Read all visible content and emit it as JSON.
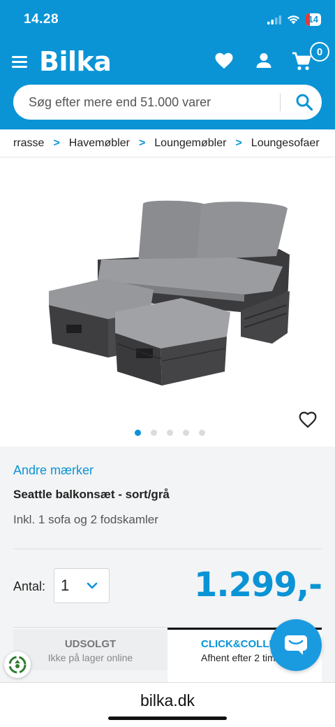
{
  "status": {
    "time": "14.28",
    "battery": "14"
  },
  "header": {
    "logo": "Bilka",
    "cart_count": "0"
  },
  "search": {
    "placeholder": "Søg efter mere end 51.000 varer"
  },
  "breadcrumb": [
    "rrasse",
    "Havemøbler",
    "Loungemøbler",
    "Loungesofaer"
  ],
  "gallery": {
    "image_count": 5,
    "active_index": 0
  },
  "product": {
    "brand": "Andre mærker",
    "title": "Seattle balkonsæt - sort/grå",
    "subtitle": "Inkl. 1 sofa og 2 fodskamler",
    "quantity_label": "Antal:",
    "quantity_value": "1",
    "price": "1.299,-"
  },
  "delivery_tabs": [
    {
      "title": "UDSOLGT",
      "text": "Ikke på lager online"
    },
    {
      "title": "CLICK&COLLECT",
      "text": "Afhent efter 2 timer"
    }
  ],
  "browser": {
    "url": "bilka.dk"
  },
  "colors": {
    "brand": "#0a94d6",
    "background": "#f3f4f5"
  }
}
